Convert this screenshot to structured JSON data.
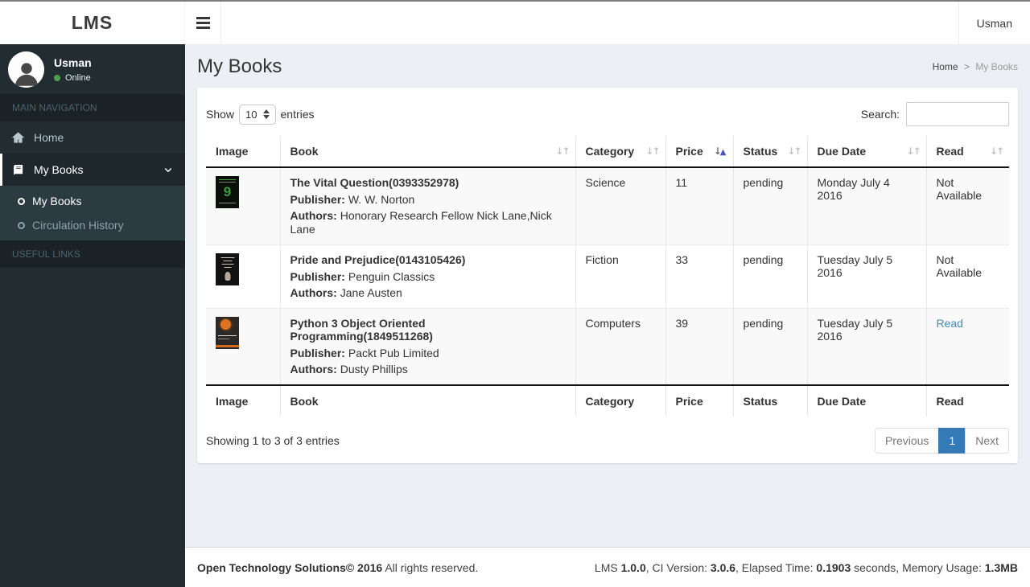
{
  "navbar": {
    "logo": "LMS",
    "username": "Usman"
  },
  "sidebar": {
    "user_name": "Usman",
    "user_status": "Online",
    "nav_header": "MAIN NAVIGATION",
    "links_header": "USEFUL LINKS",
    "home_label": "Home",
    "my_books_label": "My Books",
    "sub_my_books_label": "My Books",
    "sub_circulation_label": "Circulation History"
  },
  "page": {
    "title": "My Books",
    "breadcrumb_home": "Home",
    "breadcrumb_sep": ">",
    "breadcrumb_current": "My Books"
  },
  "controls": {
    "show_label": "Show",
    "entries_per_page": "10",
    "entries_label": "entries",
    "search_label": "Search:",
    "search_value": ""
  },
  "table": {
    "columns": [
      "Image",
      "Book",
      "Category",
      "Price",
      "Status",
      "Due Date",
      "Read"
    ],
    "publisher_label": "Publisher:",
    "authors_label": "Authors:",
    "sorted_column": "Price",
    "rows": [
      {
        "title": "The Vital Question(0393352978)",
        "publisher": "W. W. Norton",
        "authors": "Honorary Research Fellow Nick Lane,Nick Lane",
        "category": "Science",
        "price": "11",
        "status": "pending",
        "due_date": "Monday July 4 2016",
        "read": "Not Available"
      },
      {
        "title": "Pride and Prejudice(0143105426)",
        "publisher": "Penguin Classics",
        "authors": "Jane Austen",
        "category": "Fiction",
        "price": "33",
        "status": "pending",
        "due_date": "Tuesday July 5 2016",
        "read": "Not Available"
      },
      {
        "title": "Python 3 Object Oriented Programming(1849511268)",
        "publisher": "Packt Pub Limited",
        "authors": "Dusty Phillips",
        "category": "Computers",
        "price": "39",
        "status": "pending",
        "due_date": "Tuesday July 5 2016",
        "read": "Read"
      }
    ],
    "info": "Showing 1 to 3 of 3 entries",
    "pagination": {
      "previous": "Previous",
      "page": "1",
      "next": "Next"
    }
  },
  "footer": {
    "company_bold": "Open Technology Solutions© 2016",
    "rights": " All rights reserved.",
    "right": [
      "LMS ",
      "1.0.0",
      ", CI Version: ",
      "3.0.6",
      ", Elapsed Time: ",
      "0.1903",
      " seconds, Memory Usage: ",
      "1.3MB"
    ]
  },
  "colors": {
    "sidebar_bg": "#222d32",
    "content_bg": "#ecf0f5",
    "pagination_active": "#337ab7",
    "link_blue": "#3c8dbc",
    "online_green": "#4d9e4d",
    "sort_active_arrow": "#4753c0"
  }
}
